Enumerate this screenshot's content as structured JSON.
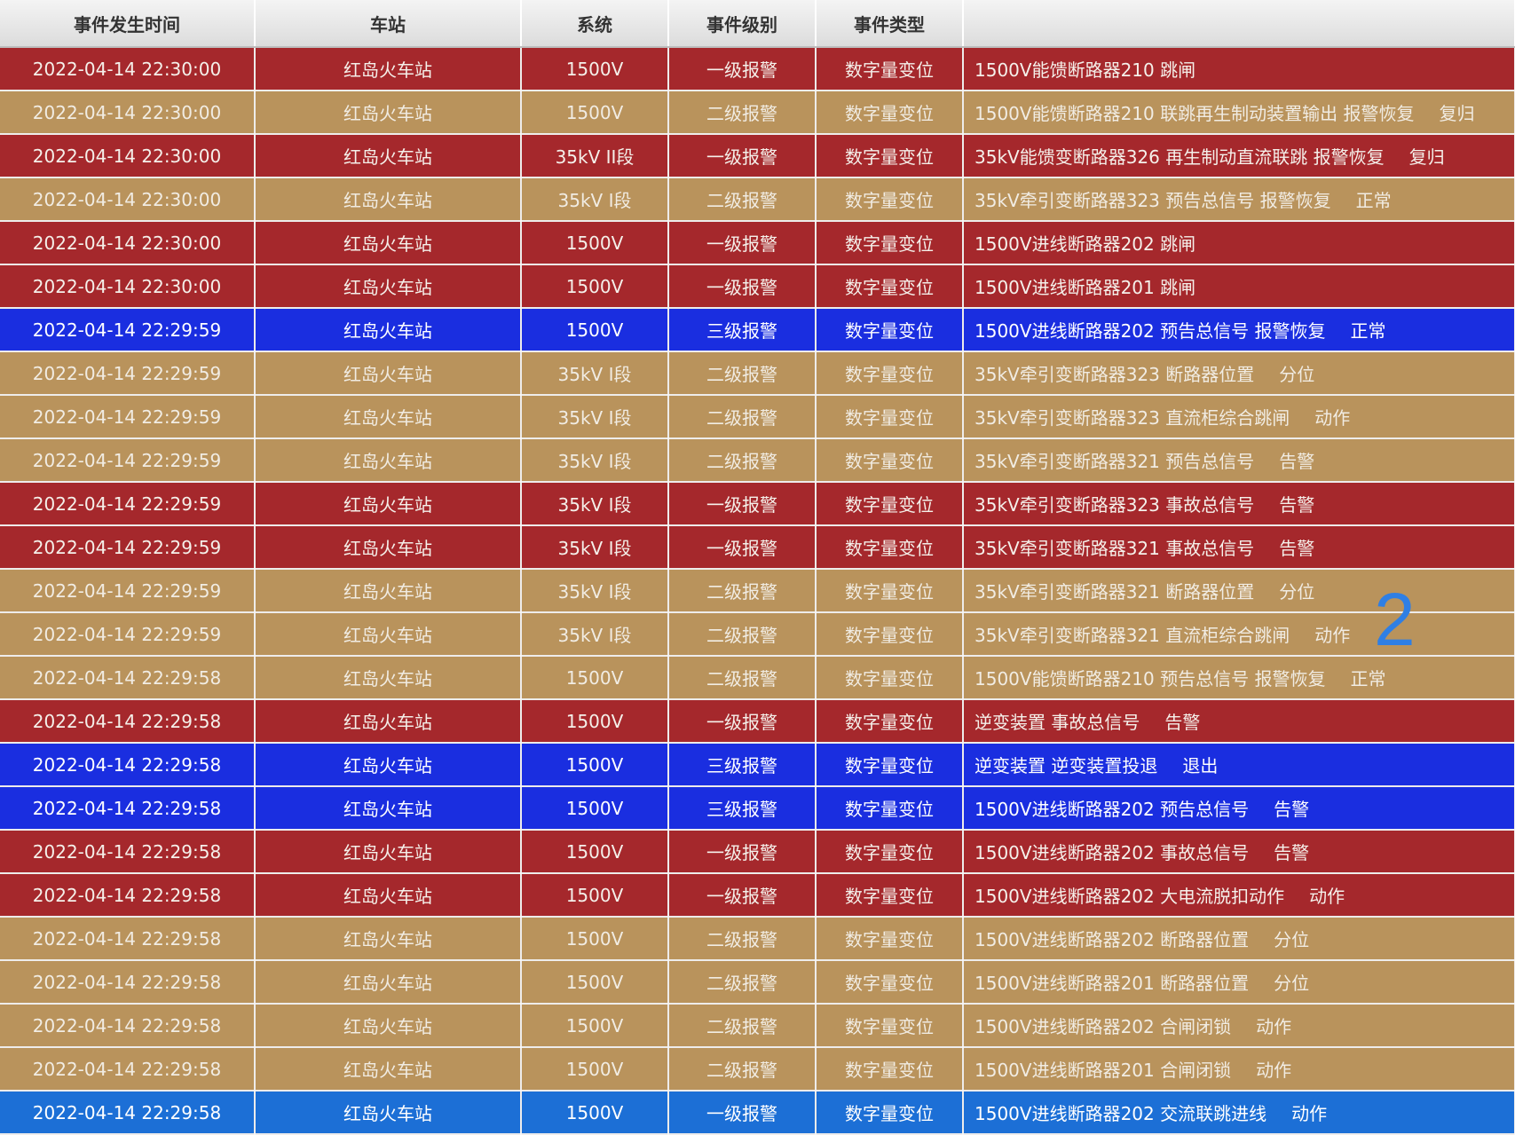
{
  "columns": [
    "事件发生时间",
    "车站",
    "系统",
    "事件级别",
    "事件类型",
    ""
  ],
  "overlay_number": "2",
  "colors": {
    "level1": "#a5282c",
    "level2": "#b9935c",
    "level3": "#1a2ee0",
    "level4": "#1c6fd6",
    "overlay": "#2f7fe4"
  },
  "rows": [
    {
      "time": "2022-04-14 22:30:00",
      "station": "红岛火车站",
      "system": "1500V",
      "level": "一级报警",
      "type": "数字量变位",
      "desc": "1500V能馈断路器210 跳闸",
      "status": "",
      "color": "lv1"
    },
    {
      "time": "2022-04-14 22:30:00",
      "station": "红岛火车站",
      "system": "1500V",
      "level": "二级报警",
      "type": "数字量变位",
      "desc": "1500V能馈断路器210 联跳再生制动装置输出 报警恢复",
      "status": "复归",
      "color": "lv2"
    },
    {
      "time": "2022-04-14 22:30:00",
      "station": "红岛火车站",
      "system": "35kV II段",
      "level": "一级报警",
      "type": "数字量变位",
      "desc": "35kV能馈变断路器326 再生制动直流联跳 报警恢复",
      "status": "复归",
      "color": "lv1"
    },
    {
      "time": "2022-04-14 22:30:00",
      "station": "红岛火车站",
      "system": "35kV I段",
      "level": "二级报警",
      "type": "数字量变位",
      "desc": "35kV牵引变断路器323 预告总信号 报警恢复",
      "status": "正常",
      "color": "lv2"
    },
    {
      "time": "2022-04-14 22:30:00",
      "station": "红岛火车站",
      "system": "1500V",
      "level": "一级报警",
      "type": "数字量变位",
      "desc": "1500V进线断路器202 跳闸",
      "status": "",
      "color": "lv1"
    },
    {
      "time": "2022-04-14 22:30:00",
      "station": "红岛火车站",
      "system": "1500V",
      "level": "一级报警",
      "type": "数字量变位",
      "desc": "1500V进线断路器201 跳闸",
      "status": "",
      "color": "lv1"
    },
    {
      "time": "2022-04-14 22:29:59",
      "station": "红岛火车站",
      "system": "1500V",
      "level": "三级报警",
      "type": "数字量变位",
      "desc": "1500V进线断路器202 预告总信号 报警恢复",
      "status": "正常",
      "color": "lv3"
    },
    {
      "time": "2022-04-14 22:29:59",
      "station": "红岛火车站",
      "system": "35kV I段",
      "level": "二级报警",
      "type": "数字量变位",
      "desc": "35kV牵引变断路器323 断路器位置",
      "status": "分位",
      "color": "lv2"
    },
    {
      "time": "2022-04-14 22:29:59",
      "station": "红岛火车站",
      "system": "35kV I段",
      "level": "二级报警",
      "type": "数字量变位",
      "desc": "35kV牵引变断路器323 直流柜综合跳闸",
      "status": "动作",
      "color": "lv2"
    },
    {
      "time": "2022-04-14 22:29:59",
      "station": "红岛火车站",
      "system": "35kV I段",
      "level": "二级报警",
      "type": "数字量变位",
      "desc": "35kV牵引变断路器321 预告总信号",
      "status": "告警",
      "color": "lv2"
    },
    {
      "time": "2022-04-14 22:29:59",
      "station": "红岛火车站",
      "system": "35kV I段",
      "level": "一级报警",
      "type": "数字量变位",
      "desc": "35kV牵引变断路器323 事故总信号",
      "status": "告警",
      "color": "lv1"
    },
    {
      "time": "2022-04-14 22:29:59",
      "station": "红岛火车站",
      "system": "35kV I段",
      "level": "一级报警",
      "type": "数字量变位",
      "desc": "35kV牵引变断路器321 事故总信号",
      "status": "告警",
      "color": "lv1"
    },
    {
      "time": "2022-04-14 22:29:59",
      "station": "红岛火车站",
      "system": "35kV I段",
      "level": "二级报警",
      "type": "数字量变位",
      "desc": "35kV牵引变断路器321 断路器位置",
      "status": "分位",
      "color": "lv2"
    },
    {
      "time": "2022-04-14 22:29:59",
      "station": "红岛火车站",
      "system": "35kV I段",
      "level": "二级报警",
      "type": "数字量变位",
      "desc": "35kV牵引变断路器321 直流柜综合跳闸",
      "status": "动作",
      "color": "lv2"
    },
    {
      "time": "2022-04-14 22:29:58",
      "station": "红岛火车站",
      "system": "1500V",
      "level": "二级报警",
      "type": "数字量变位",
      "desc": "1500V能馈断路器210 预告总信号 报警恢复",
      "status": "正常",
      "color": "lv2"
    },
    {
      "time": "2022-04-14 22:29:58",
      "station": "红岛火车站",
      "system": "1500V",
      "level": "一级报警",
      "type": "数字量变位",
      "desc": "逆变装置 事故总信号",
      "status": "告警",
      "color": "lv1"
    },
    {
      "time": "2022-04-14 22:29:58",
      "station": "红岛火车站",
      "system": "1500V",
      "level": "三级报警",
      "type": "数字量变位",
      "desc": "逆变装置 逆变装置投退",
      "status": "退出",
      "color": "lv3"
    },
    {
      "time": "2022-04-14 22:29:58",
      "station": "红岛火车站",
      "system": "1500V",
      "level": "三级报警",
      "type": "数字量变位",
      "desc": "1500V进线断路器202 预告总信号",
      "status": "告警",
      "color": "lv3"
    },
    {
      "time": "2022-04-14 22:29:58",
      "station": "红岛火车站",
      "system": "1500V",
      "level": "一级报警",
      "type": "数字量变位",
      "desc": "1500V进线断路器202 事故总信号",
      "status": "告警",
      "color": "lv1"
    },
    {
      "time": "2022-04-14 22:29:58",
      "station": "红岛火车站",
      "system": "1500V",
      "level": "一级报警",
      "type": "数字量变位",
      "desc": "1500V进线断路器202 大电流脱扣动作",
      "status": "动作",
      "color": "lv1"
    },
    {
      "time": "2022-04-14 22:29:58",
      "station": "红岛火车站",
      "system": "1500V",
      "level": "二级报警",
      "type": "数字量变位",
      "desc": "1500V进线断路器202 断路器位置",
      "status": "分位",
      "color": "lv2"
    },
    {
      "time": "2022-04-14 22:29:58",
      "station": "红岛火车站",
      "system": "1500V",
      "level": "二级报警",
      "type": "数字量变位",
      "desc": "1500V进线断路器201 断路器位置",
      "status": "分位",
      "color": "lv2"
    },
    {
      "time": "2022-04-14 22:29:58",
      "station": "红岛火车站",
      "system": "1500V",
      "level": "二级报警",
      "type": "数字量变位",
      "desc": "1500V进线断路器202 合闸闭锁",
      "status": "动作",
      "color": "lv2"
    },
    {
      "time": "2022-04-14 22:29:58",
      "station": "红岛火车站",
      "system": "1500V",
      "level": "二级报警",
      "type": "数字量变位",
      "desc": "1500V进线断路器201 合闸闭锁",
      "status": "动作",
      "color": "lv2"
    },
    {
      "time": "2022-04-14 22:29:58",
      "station": "红岛火车站",
      "system": "1500V",
      "level": "一级报警",
      "type": "数字量变位",
      "desc": "1500V进线断路器202 交流联跳进线",
      "status": "动作",
      "color": "lv4"
    }
  ]
}
